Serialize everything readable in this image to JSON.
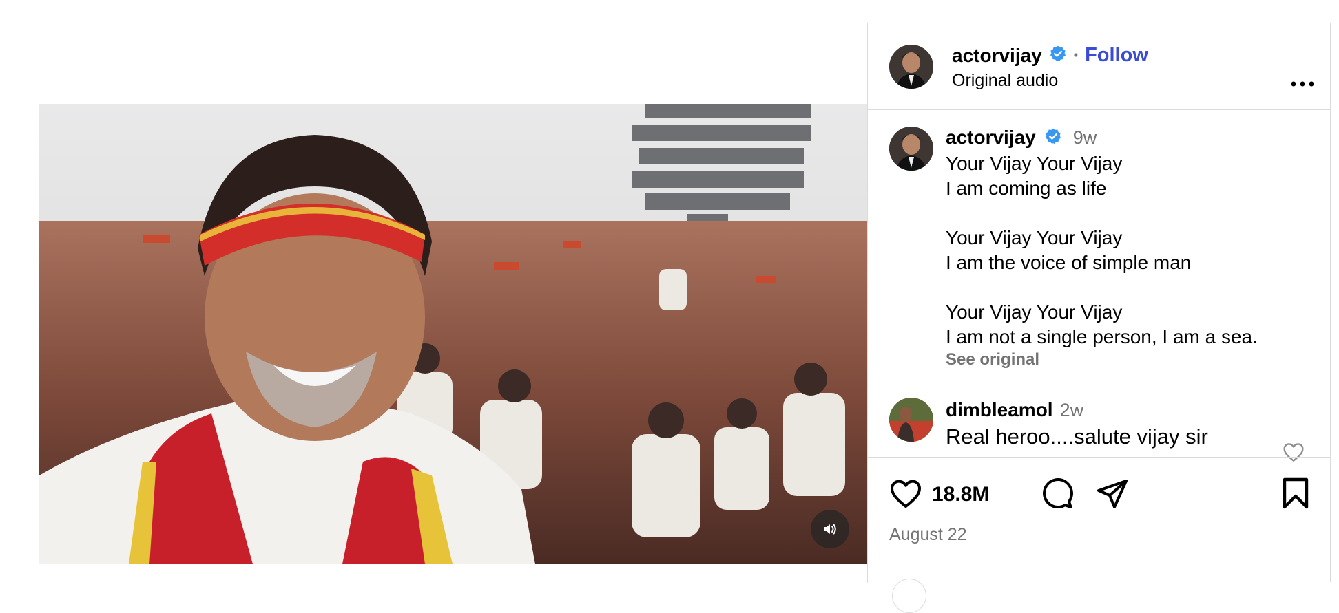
{
  "post": {
    "username": "actorvijay",
    "follow_label": "Follow",
    "separator": "•",
    "audio": "Original audio",
    "more_icon": "more-horizontal-icon"
  },
  "caption": {
    "username": "actorvijay",
    "age": "9w",
    "lines": [
      "Your Vijay Your Vijay",
      "I am coming as life",
      "",
      "Your Vijay Your Vijay",
      "I am the voice of simple man",
      "",
      "Your Vijay Your Vijay",
      "I am not a single person, I am a sea."
    ],
    "see_original": "See original"
  },
  "comment": {
    "username": "dimbleamol",
    "age": "2w",
    "text": "Real heroo....salute vijay sir"
  },
  "actions": {
    "likes": "18.8M",
    "date": "August 22"
  },
  "colors": {
    "link": "#3a4bd6",
    "verified": "#3897f0",
    "muted": "#737373",
    "border": "#dbdbdb"
  }
}
